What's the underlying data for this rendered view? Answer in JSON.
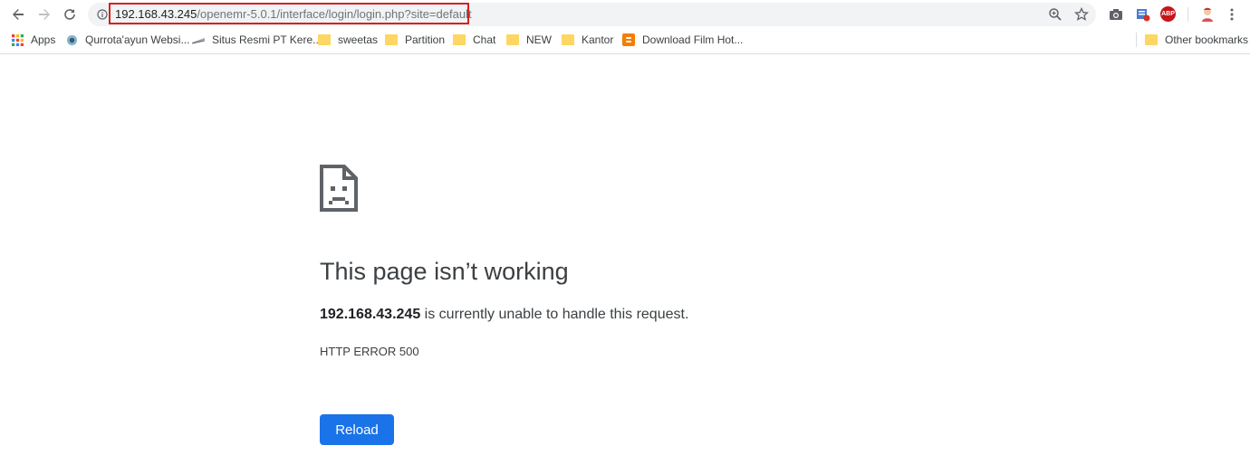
{
  "url": {
    "host": "192.168.43.245",
    "path": "/openemr-5.0.1/interface/login/login.php?site=default"
  },
  "bookmarks": [
    {
      "label": "Apps",
      "icon": "apps-grid-icon"
    },
    {
      "label": "Qurrota'ayun Websi...",
      "icon": "site-favicon"
    },
    {
      "label": "Situs Resmi PT Kere...",
      "icon": "train-icon"
    },
    {
      "label": "sweetas",
      "icon": "folder-icon"
    },
    {
      "label": "Partition",
      "icon": "folder-icon"
    },
    {
      "label": "Chat",
      "icon": "folder-icon"
    },
    {
      "label": "NEW",
      "icon": "folder-icon"
    },
    {
      "label": "Kantor",
      "icon": "folder-icon"
    },
    {
      "label": "Download Film Hot...",
      "icon": "blogger-icon"
    }
  ],
  "other_bookmarks": "Other bookmarks",
  "extensions": {
    "abp_label": "ABP"
  },
  "error": {
    "title": "This page isn’t working",
    "host": "192.168.43.245",
    "message": " is currently unable to handle this request.",
    "code": "HTTP ERROR 500",
    "reload_label": "Reload"
  },
  "colors": {
    "accent": "#1a73e8",
    "highlight": "#d9201f"
  }
}
